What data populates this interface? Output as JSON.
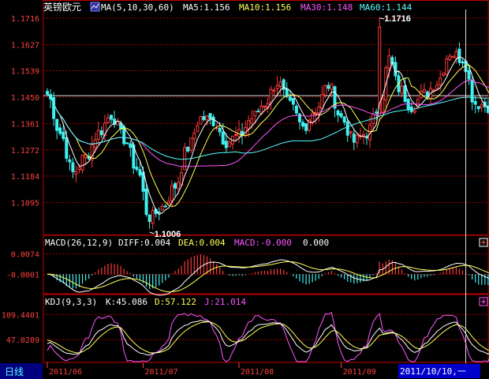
{
  "header": {
    "symbol": "英镑欧元",
    "ma_params": "MA(5,10,30,60)",
    "ma5": "MA5:1.156",
    "ma10": "MA10:1.156",
    "ma30": "MA30:1.148",
    "ma60": "MA60:1.144"
  },
  "macd_header": {
    "params": "MACD(26,12,9)",
    "diff": "DIFF:0.004",
    "dea": "DEA:0.004",
    "macd": "MACD:-0.000",
    "extra": "0.000"
  },
  "kdj_header": {
    "params": "KDJ(9,3,3)",
    "k": "K:45.086",
    "d": "D:57.122",
    "j": "J:21.014"
  },
  "footer": {
    "period_label": "日线",
    "cursor_date": "2011/10/10,一"
  },
  "colors": {
    "up": "#ff3b3b",
    "down": "#3ff0f0",
    "ma5": "#ffffff",
    "ma10": "#ffff55",
    "ma30": "#ff55ff",
    "ma60": "#55ffff",
    "grid": "#a00000",
    "frame": "#c00000",
    "axis_text": "#ff4040"
  },
  "icons": {
    "ma_toggle": "chart-icon",
    "macd_add": "plus-icon",
    "kdj_add": "plus-icon"
  },
  "chart_data": {
    "type": "candlestick",
    "price_ticks": [
      "1.1716",
      "1.1627",
      "1.1539",
      "1.1450",
      "1.1361",
      "1.1272",
      "1.1184",
      "1.1095"
    ],
    "price_range": [
      1.099,
      1.1745
    ],
    "macd_ticks": [
      "0.0074",
      "-0.0001"
    ],
    "macd_range": [
      -0.0065,
      0.0095
    ],
    "kdj_ticks": [
      "109.4401",
      "47.0289"
    ],
    "kdj_range": [
      -8,
      130
    ],
    "date_labels": [
      "2011/06",
      "2011/07",
      "2011/08",
      "2011/09",
      "2011/10/10,一"
    ],
    "date_label_index": [
      0,
      30,
      60,
      92,
      131
    ],
    "annotations": [
      {
        "label": "1.1716",
        "value": 1.1716,
        "index": 104
      },
      {
        "label": "1.1006",
        "value": 1.1006,
        "index": 32
      }
    ],
    "reference_line": 1.1455,
    "cursor_index": 131,
    "anchors": [
      [
        0,
        1.146
      ],
      [
        4,
        1.133
      ],
      [
        8,
        1.1195
      ],
      [
        12,
        1.125
      ],
      [
        16,
        1.133
      ],
      [
        20,
        1.139
      ],
      [
        24,
        1.131
      ],
      [
        28,
        1.121
      ],
      [
        32,
        1.104
      ],
      [
        36,
        1.108
      ],
      [
        40,
        1.115
      ],
      [
        44,
        1.128
      ],
      [
        48,
        1.138
      ],
      [
        52,
        1.137
      ],
      [
        56,
        1.13
      ],
      [
        60,
        1.132
      ],
      [
        64,
        1.138
      ],
      [
        68,
        1.143
      ],
      [
        72,
        1.15
      ],
      [
        76,
        1.142
      ],
      [
        80,
        1.135
      ],
      [
        84,
        1.141
      ],
      [
        88,
        1.149
      ],
      [
        92,
        1.138
      ],
      [
        96,
        1.13
      ],
      [
        100,
        1.133
      ],
      [
        104,
        1.142
      ],
      [
        107,
        1.158
      ],
      [
        110,
        1.148
      ],
      [
        114,
        1.142
      ],
      [
        118,
        1.146
      ],
      [
        122,
        1.15
      ],
      [
        126,
        1.16
      ],
      [
        130,
        1.158
      ],
      [
        134,
        1.143
      ],
      [
        138,
        1.142
      ]
    ]
  }
}
